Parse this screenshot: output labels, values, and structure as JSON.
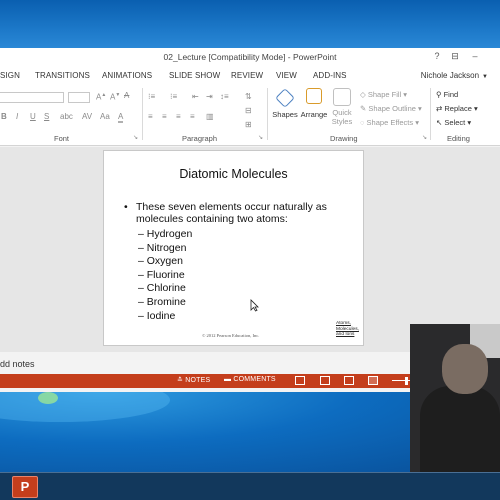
{
  "window": {
    "title": "02_Lecture [Compatibility Mode] - PowerPoint",
    "controls": [
      "?",
      "⊟",
      "–"
    ]
  },
  "tabs": [
    "SIGN",
    "TRANSITIONS",
    "ANIMATIONS",
    "SLIDE SHOW",
    "REVIEW",
    "VIEW",
    "ADD-INS"
  ],
  "user": "Nichole Jackson",
  "ribbon": {
    "font_group": "Font",
    "paragraph_group": "Paragraph",
    "drawing_group": "Drawing",
    "editing_group": "Editing",
    "font_buttons": [
      "B",
      "I",
      "U",
      "S"
    ],
    "shapes": "Shapes",
    "arrange": "Arrange",
    "quick_styles_1": "Quick",
    "quick_styles_2": "Styles",
    "shape_fill": "Shape Fill",
    "shape_outline": "Shape Outline",
    "shape_effects": "Shape Effects",
    "find": "Find",
    "replace": "Replace",
    "select": "Select"
  },
  "slide": {
    "title": "Diatomic Molecules",
    "bullet": "These seven elements occur naturally as molecules containing two atoms:",
    "items": [
      "– Hydrogen",
      "– Nitrogen",
      "– Oxygen",
      "– Fluorine",
      "– Chlorine",
      "– Bromine",
      "– Iodine"
    ],
    "copyright": "© 2012 Pearson Education, Inc.",
    "logo": [
      "Atoms,",
      "Molecules,",
      "and Ions"
    ]
  },
  "notes_prompt": "dd notes",
  "statusbar": {
    "notes": "NOTES",
    "comments": "COMMENTS",
    "color": "#c43e1c"
  },
  "taskbar": {
    "app": "P"
  }
}
